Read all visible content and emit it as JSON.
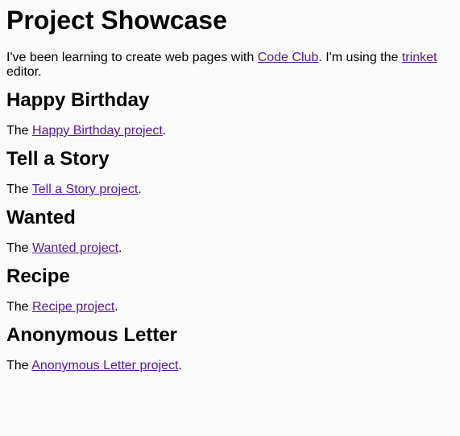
{
  "page": {
    "title": "Project Showcase",
    "intro": {
      "text1": "I've been learning to create web pages with ",
      "link1": "Code Club",
      "text2": ". I'm using the ",
      "link2": "trinket",
      "text3": " editor."
    },
    "sections": [
      {
        "heading": "Happy Birthday",
        "prefix": "The ",
        "link": "Happy Birthday project",
        "suffix": "."
      },
      {
        "heading": "Tell a Story",
        "prefix": "The ",
        "link": "Tell a Story project",
        "suffix": "."
      },
      {
        "heading": "Wanted",
        "prefix": "The ",
        "link": "Wanted project",
        "suffix": "."
      },
      {
        "heading": "Recipe",
        "prefix": "The ",
        "link": "Recipe project",
        "suffix": "."
      },
      {
        "heading": "Anonymous Letter",
        "prefix": "The ",
        "link": "Anonymous Letter project",
        "suffix": "."
      }
    ],
    "link_color": "#551a8b"
  }
}
